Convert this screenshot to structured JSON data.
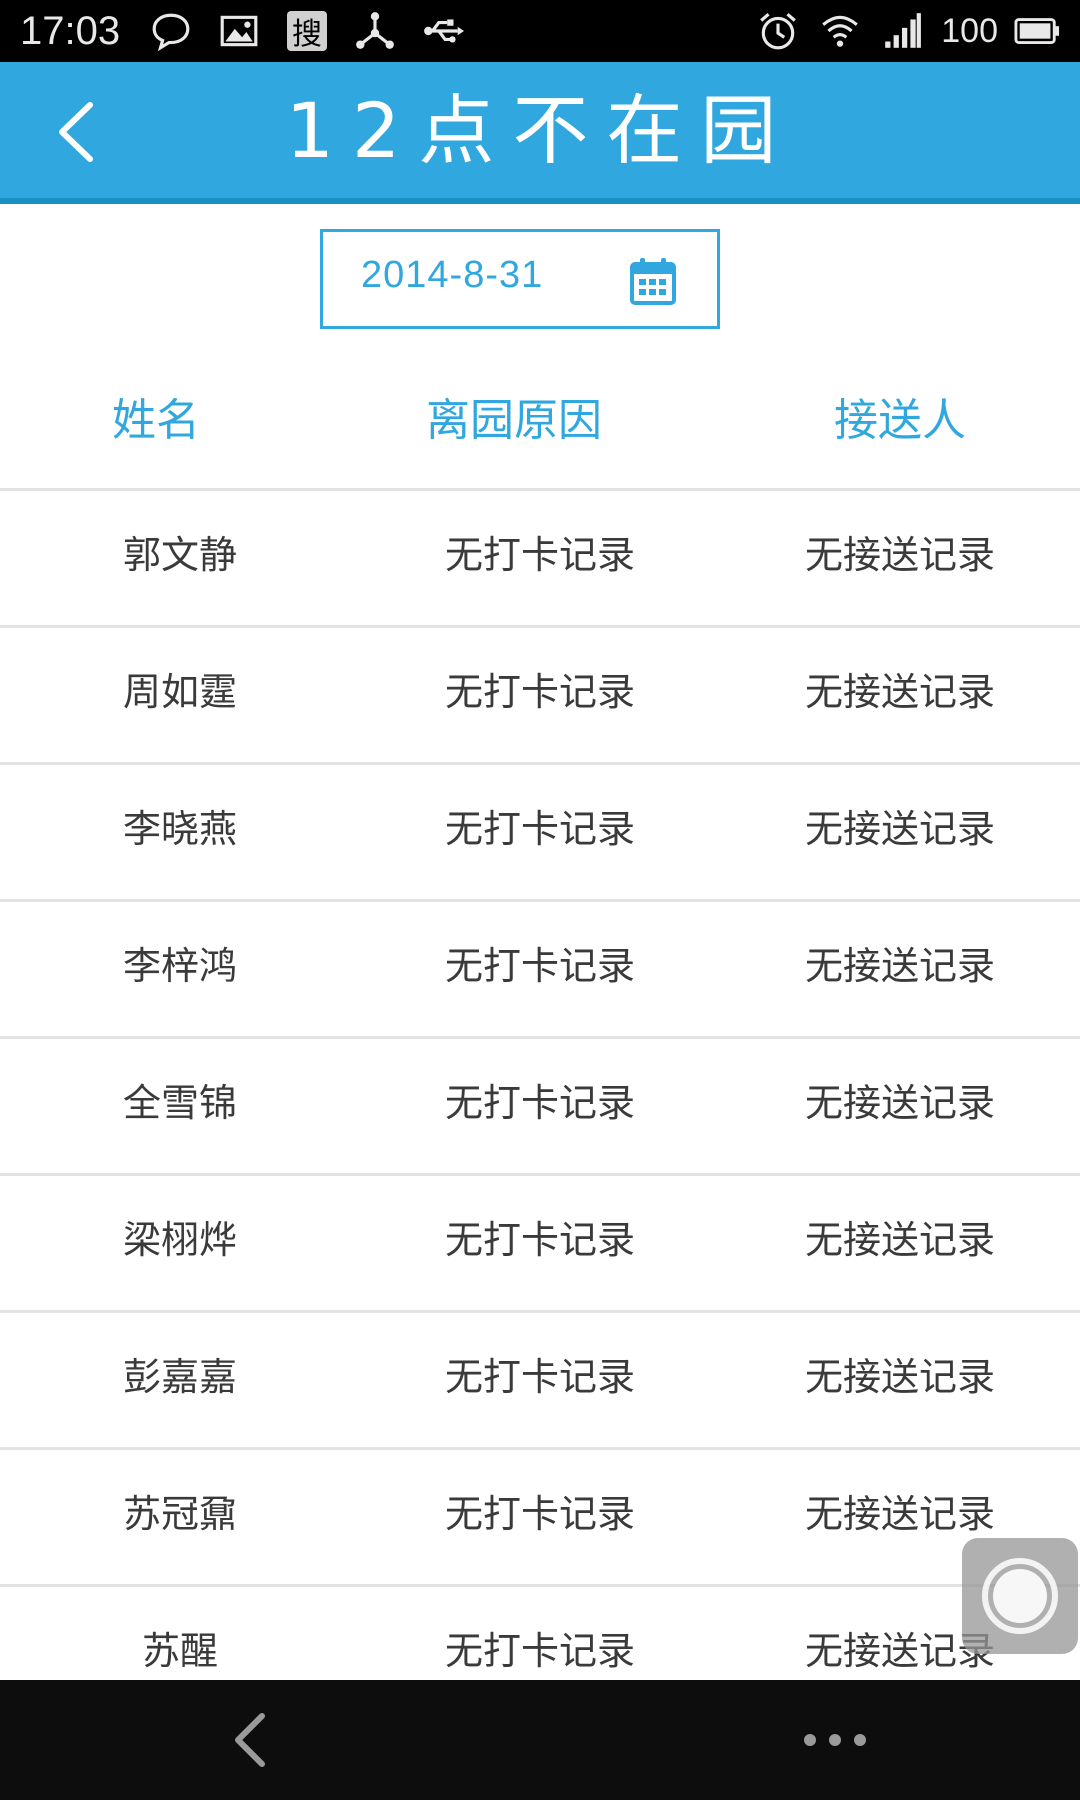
{
  "status_bar": {
    "time": "17:03",
    "left_icons": [
      "chat-bubble-icon",
      "image-icon",
      "sou-app-icon",
      "network-share-icon",
      "usb-icon"
    ],
    "sou_glyph": "搜",
    "right_icons": [
      "alarm-icon",
      "wifi-icon",
      "signal-icon",
      "battery-icon"
    ],
    "battery": "100"
  },
  "header": {
    "title": "12点不在园",
    "back_icon": "chevron-left-icon",
    "background": "#31a7df"
  },
  "date_picker": {
    "value": "2014-8-31",
    "icon": "calendar-icon"
  },
  "table": {
    "headers": [
      "姓名",
      "离园原因",
      "接送人"
    ],
    "rows": [
      {
        "name": "郭文静",
        "reason": "无打卡记录",
        "pickup": "无接送记录"
      },
      {
        "name": "周如霆",
        "reason": "无打卡记录",
        "pickup": "无接送记录"
      },
      {
        "name": "李晓燕",
        "reason": "无打卡记录",
        "pickup": "无接送记录"
      },
      {
        "name": "李梓鸿",
        "reason": "无打卡记录",
        "pickup": "无接送记录"
      },
      {
        "name": "全雪锦",
        "reason": "无打卡记录",
        "pickup": "无接送记录"
      },
      {
        "name": "梁栩烨",
        "reason": "无打卡记录",
        "pickup": "无接送记录"
      },
      {
        "name": "彭嘉嘉",
        "reason": "无打卡记录",
        "pickup": "无接送记录"
      },
      {
        "name": "苏冠鼐",
        "reason": "无打卡记录",
        "pickup": "无接送记录"
      },
      {
        "name": "苏醒",
        "reason": "无打卡记录",
        "pickup": "无接送记录"
      }
    ]
  },
  "colors": {
    "accent": "#31a7df",
    "text": "#3a3a3a",
    "divider": "#e3e3e3"
  },
  "nav_bar": {
    "icons": [
      "back-triangle-icon",
      "more-dots-icon"
    ]
  }
}
